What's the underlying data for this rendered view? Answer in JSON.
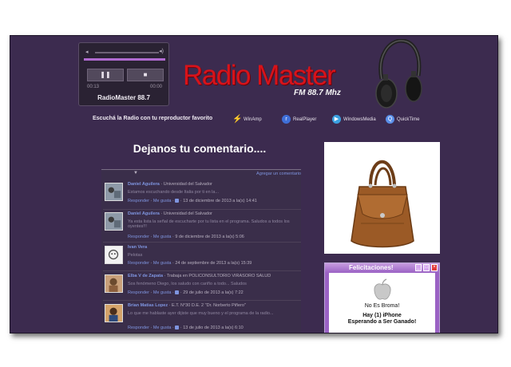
{
  "player": {
    "time_current": "00:13",
    "time_total": "00:00",
    "station_name": "RadioMaster 88.7",
    "pause_icon": "pause-icon",
    "stop_icon": "stop-icon",
    "volume_icons": [
      "volume-low-icon",
      "volume-high-icon"
    ],
    "progress_fraction": 1.0
  },
  "logo": {
    "title": "Radio Master",
    "subtitle": "FM 88.7 Mhz"
  },
  "players_row": {
    "prompt": "Escuchá la Radio con tu reproductor favorito",
    "apps": [
      {
        "label": "WinAmp",
        "icon": "winamp-icon"
      },
      {
        "label": "RealPlayer",
        "icon": "realplayer-icon"
      },
      {
        "label": "WindowsMedia",
        "icon": "windowsmedia-icon"
      },
      {
        "label": "QuickTime",
        "icon": "quicktime-icon"
      }
    ]
  },
  "comments_section": {
    "title": "Dejanos tu comentario....",
    "add_comment": "Agregar un comentario",
    "comments": [
      {
        "author": "Daniel Aguilera",
        "affiliation": " · Universidad del Salvador",
        "text": "Estamos escuchando desde Italia por ti en la...",
        "reply": "Responder",
        "like": "Me gusta",
        "date": " · 13 de diciembre de 2013 a la(s) 14:41"
      },
      {
        "author": "Daniel Aguilera",
        "affiliation": " · Universidad del Salvador",
        "text": "Ya esta lista la señal de escucharte por tu lista en el programa. Saludos a todos los oyentes!!!",
        "reply": "Responder",
        "like": "Me gusta",
        "date": " · 9 de diciembre de 2013 a la(s) 5:06"
      },
      {
        "author": "Ivan Vera",
        "affiliation": "",
        "text": "Pelotas",
        "reply": "Responder",
        "like": "Me gusta",
        "date": " · 24 de septiembre de 2013 a la(s) 15:39"
      },
      {
        "author": "Elba V de Zapata",
        "affiliation": " · Trabaja en POLICONSULTORIO VIRASORO SALUD",
        "text": "Sos fenómeno Diego, los saludo con cariño a todo... Saludos",
        "reply": "Responder",
        "like": "Me gusta",
        "date": " · 29 de julio de 2013 a la(s) 7:22"
      },
      {
        "author": "Brian Matias Lopez",
        "affiliation": " · E.T. N°30 D.E. 2 \"Dr. Norberto Piñero\"",
        "text": "Lo que me hablaste ayer dijiste que muy bueno y el programa de la radio...",
        "reply": "Responder",
        "like": "Me gusta",
        "date": " · 13 de julio de 2013 a la(s) 6:10"
      }
    ]
  },
  "popup": {
    "title": "Felicitaciones!",
    "line1": "No Es Broma!",
    "line2": "Hay (1) iPhone",
    "line3": "Esperando a Ser Ganado!",
    "min_label": "_",
    "max_label": "□",
    "close_label": "×"
  },
  "colors": {
    "background": "#3c2b4f",
    "logo_red": "#d8131a",
    "link_blue": "#7f95e0",
    "popup_purple": "#9a62c4"
  }
}
